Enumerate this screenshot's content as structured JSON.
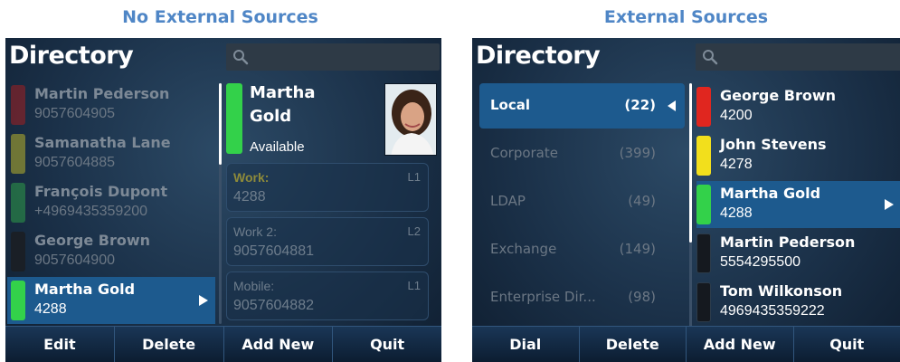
{
  "captions": {
    "left": "No External Sources",
    "right": "External Sources"
  },
  "left_screen": {
    "title": "Directory",
    "search_icon": "search-icon",
    "contacts": [
      {
        "name": "Martin Pederson",
        "number": "9057604905",
        "status_color": "#b01d1d"
      },
      {
        "name": "Samanatha Lane",
        "number": "9057604885",
        "status_color": "#c8c02a"
      },
      {
        "name": "François Dupont",
        "number": "+4969435359200",
        "status_color": "#2fa84a"
      },
      {
        "name": "George Brown",
        "number": "9057604900",
        "status_color": "#1a1f26"
      },
      {
        "name": "Martha Gold",
        "number": "4288",
        "status_color": "#33d14a",
        "selected": true
      }
    ],
    "detail": {
      "name_line1": "Martha",
      "name_line2": "Gold",
      "status": "Available",
      "status_color": "#33d14a",
      "fields": [
        {
          "label": "Work:",
          "line": "L1",
          "value": "4288",
          "highlight": true
        },
        {
          "label": "Work 2:",
          "line": "L2",
          "value": "9057604881"
        },
        {
          "label": "Mobile:",
          "line": "L1",
          "value": "9057604882"
        }
      ]
    },
    "softkeys": [
      "Edit",
      "Delete",
      "Add New",
      "Quit"
    ]
  },
  "right_screen": {
    "title": "Directory",
    "search_icon": "search-icon",
    "sources": [
      {
        "label": "Local",
        "count": "(22)",
        "selected": true
      },
      {
        "label": "Corporate",
        "count": "(399)"
      },
      {
        "label": "LDAP",
        "count": "(49)"
      },
      {
        "label": "Exchange",
        "count": "(149)"
      },
      {
        "label": "Enterprise Dir...",
        "count": "(98)"
      }
    ],
    "contacts": [
      {
        "name": "George Brown",
        "number": "4200",
        "status_color": "#e0261f"
      },
      {
        "name": "John Stevens",
        "number": "4278",
        "status_color": "#f2df1c"
      },
      {
        "name": "Martha Gold",
        "number": "4288",
        "status_color": "#33d14a",
        "selected": true
      },
      {
        "name": "Martin Pederson",
        "number": "5554295500",
        "status_color": "#15191f"
      },
      {
        "name": "Tom Wilkonson",
        "number": "4969435359222",
        "status_color": "#15191f"
      }
    ],
    "softkeys": [
      "Dial",
      "Delete",
      "Add New",
      "Quit"
    ]
  }
}
